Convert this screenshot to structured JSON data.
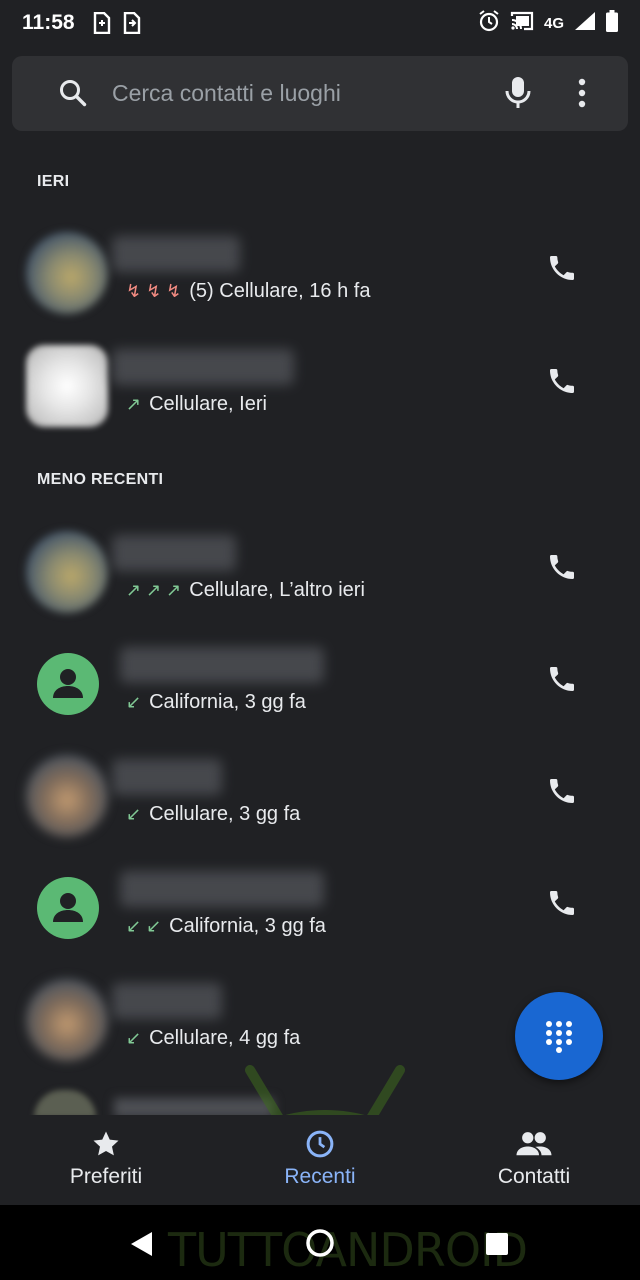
{
  "status_bar": {
    "time": "11:58",
    "network": "4G"
  },
  "search": {
    "placeholder": "Cerca contatti e luoghi"
  },
  "sections": {
    "yesterday": "IERI",
    "older": "MENO RECENTI"
  },
  "calls": [
    {
      "detail": "(5) Cellulare, 16 h fa",
      "call_type": "missed",
      "arrow_count": 3,
      "avatar": "photo"
    },
    {
      "detail": "Cellulare, Ieri",
      "call_type": "outgoing",
      "arrow_count": 1,
      "avatar": "photo"
    },
    {
      "detail": "Cellulare, L’altro ieri",
      "call_type": "outgoing",
      "arrow_count": 3,
      "avatar": "photo"
    },
    {
      "detail": "California, 3 gg fa",
      "call_type": "incoming",
      "arrow_count": 1,
      "avatar": "generic"
    },
    {
      "detail": "Cellulare, 3 gg fa",
      "call_type": "incoming",
      "arrow_count": 1,
      "avatar": "photo"
    },
    {
      "detail": "California, 3 gg fa",
      "call_type": "incoming",
      "arrow_count": 2,
      "avatar": "generic"
    },
    {
      "detail": "Cellulare, 4 gg fa",
      "call_type": "incoming",
      "arrow_count": 1,
      "avatar": "photo"
    }
  ],
  "bottom_nav": {
    "favorites": "Preferiti",
    "recents": "Recenti",
    "contacts": "Contatti",
    "active": "recents"
  },
  "watermark": {
    "brand": "TUTTOANDROID"
  },
  "colors": {
    "background": "#202124",
    "accent": "#8ab4f8",
    "fab": "#1967d2",
    "missed": "#f28b82",
    "answered": "#81c995",
    "avatar_generic": "#5bb974"
  }
}
